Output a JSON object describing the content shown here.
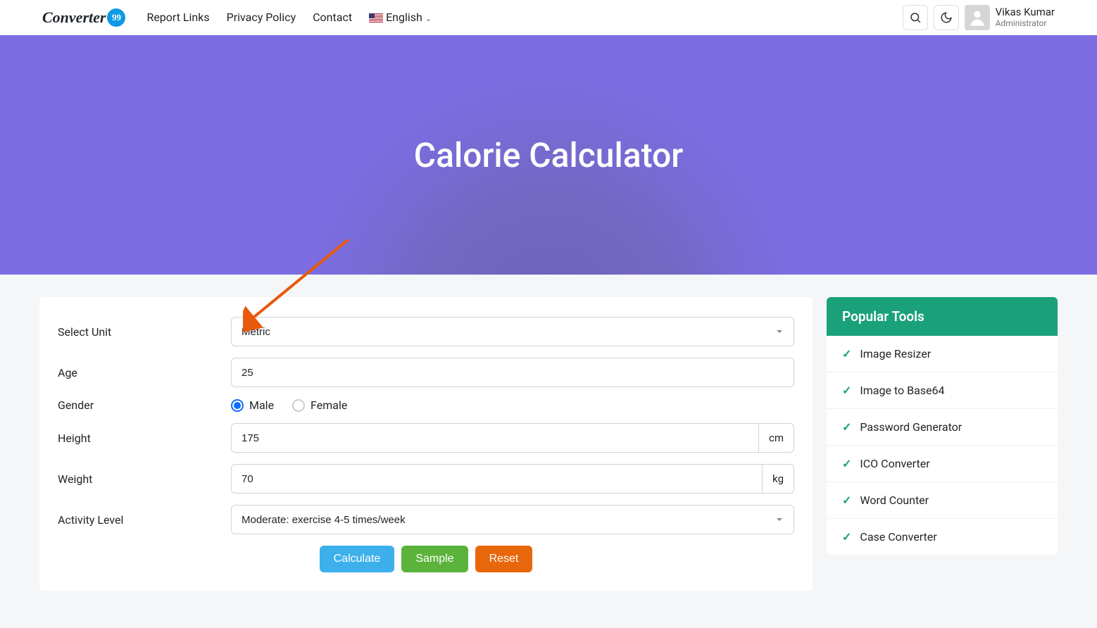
{
  "logo": {
    "text": "Converter",
    "badge": "99"
  },
  "nav": {
    "items": [
      "Report Links",
      "Privacy Policy",
      "Contact"
    ],
    "lang": "English"
  },
  "user": {
    "name": "Vikas Kumar",
    "role": "Administrator"
  },
  "hero": {
    "title": "Calorie Calculator"
  },
  "form": {
    "unit": {
      "label": "Select Unit",
      "value": "Metric"
    },
    "age": {
      "label": "Age",
      "value": "25"
    },
    "gender": {
      "label": "Gender",
      "male": "Male",
      "female": "Female",
      "selected": "male"
    },
    "height": {
      "label": "Height",
      "value": "175",
      "unit": "cm"
    },
    "weight": {
      "label": "Weight",
      "value": "70",
      "unit": "kg"
    },
    "activity": {
      "label": "Activity Level",
      "value": "Moderate: exercise 4-5 times/week"
    },
    "buttons": {
      "calculate": "Calculate",
      "sample": "Sample",
      "reset": "Reset"
    }
  },
  "sidebar": {
    "title": "Popular Tools",
    "items": [
      "Image Resizer",
      "Image to Base64",
      "Password Generator",
      "ICO Converter",
      "Word Counter",
      "Case Converter"
    ]
  }
}
